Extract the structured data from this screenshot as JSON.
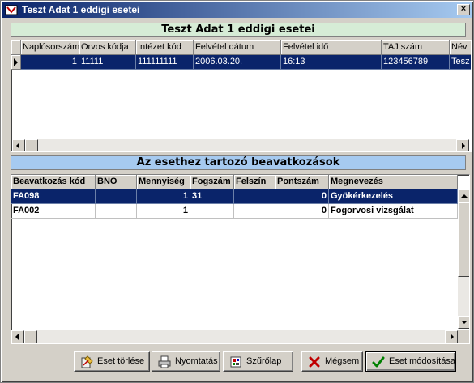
{
  "window": {
    "title": "Teszt Adat 1 eddigi esetei",
    "close_label": "×"
  },
  "cases": {
    "heading": "Teszt Adat 1 eddigi esetei",
    "columns": [
      "Naplósorszám",
      "Orvos kódja",
      "Intézet kód",
      "Felvétel dátum",
      "Felvétel idő",
      "TAJ szám",
      "Név"
    ],
    "rows": [
      [
        "1",
        "11111",
        "111111111",
        "2006.03.20.",
        "16:13",
        "123456789",
        "Tesz"
      ]
    ]
  },
  "procedures": {
    "heading": "Az esethez tartozó beavatkozások",
    "columns": [
      "Beavatkozás kód",
      "BNO",
      "Mennyiség",
      "Fogszám",
      "Felszín",
      "Pontszám",
      "Megnevezés"
    ],
    "rows": [
      [
        "FA098",
        "",
        "1",
        "31",
        "",
        "0",
        "Gyökérkezelés"
      ],
      [
        "FA002",
        "",
        "1",
        "",
        "",
        "0",
        "Fogorvosi vizsgálat"
      ]
    ]
  },
  "buttons": {
    "delete_case": "Eset törlése",
    "print": "Nyomtatás",
    "screening": "Szűrőlap",
    "cancel": "Mégsem",
    "modify_case": "Eset módosítása"
  },
  "icons": {
    "app": "app-icon",
    "delete_case": "delete-case-icon",
    "print": "printer-icon",
    "screening": "screening-icon",
    "cancel": "red-x-icon",
    "modify_case": "green-check-icon"
  },
  "colors": {
    "selection": "#0a246a",
    "title_gradient_start": "#0a246a",
    "title_gradient_end": "#a6caf0",
    "heading_green": "#d6ecd6",
    "heading_blue": "#a6caf0"
  }
}
